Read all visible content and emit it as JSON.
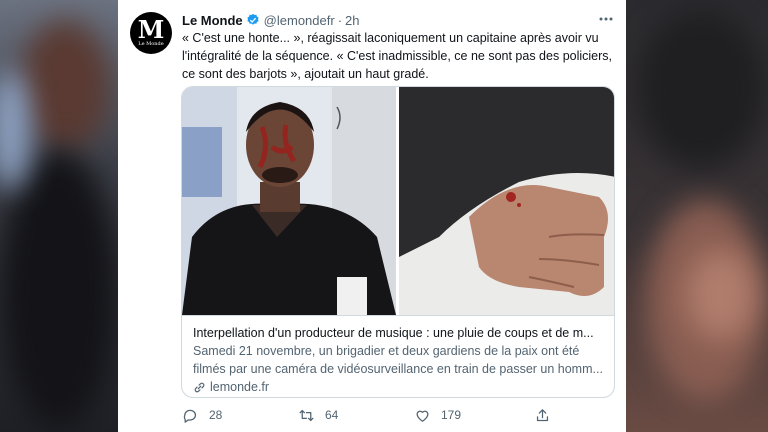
{
  "tweet": {
    "author_name": "Le Monde",
    "handle": "@lemondefr",
    "separator": "·",
    "time": "2h",
    "avatar_letter": "M",
    "avatar_sub": "Le Monde",
    "text_lines": [
      "« C'est une honte... », réagissait laconiquement un capitaine après avoir vu",
      "l'intégralité de la séquence. « C'est inadmissible, ce ne sont pas des policiers,",
      "ce sont des barjots », ajoutait un haut gradé."
    ]
  },
  "link_card": {
    "title": "Interpellation d'un producteur de musique : une pluie de coups et de m...",
    "desc_lines": [
      "Samedi 21 novembre, un brigadier et deux gardiens de la paix ont été",
      "filmés par une caméra de vidéosurveillance en train de passer un homm..."
    ],
    "domain": "lemonde.fr"
  },
  "actions": {
    "reply_count": "28",
    "retweet_count": "64",
    "like_count": "179"
  },
  "icons": [
    "verified-icon",
    "more-icon",
    "link-icon",
    "reply-icon",
    "retweet-icon",
    "like-icon",
    "share-icon"
  ],
  "colors": {
    "verified": "#1d9bf0",
    "text": "#0f1419",
    "secondary": "#536471",
    "border": "#cfd9de"
  }
}
